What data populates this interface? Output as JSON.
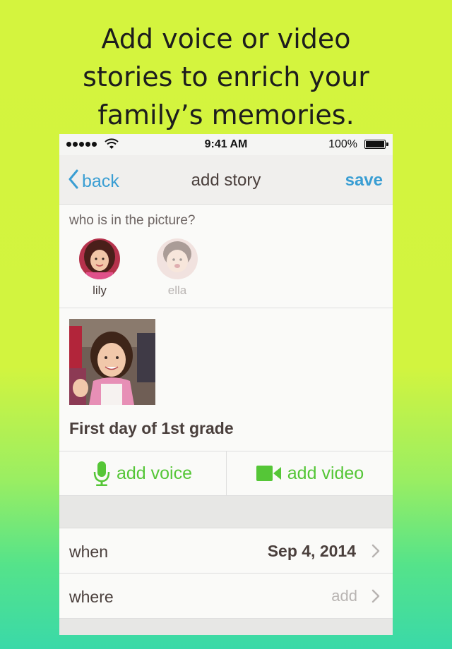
{
  "headline": {
    "line1": "Add voice or video",
    "line2": "stories to enrich your",
    "line3": "family’s memories."
  },
  "status_bar": {
    "time": "9:41 AM",
    "battery": "100%"
  },
  "nav": {
    "back_label": "back",
    "title": "add story",
    "save_label": "save"
  },
  "people": {
    "prompt": "who is in the picture?",
    "items": [
      {
        "name": "lily",
        "selected": true
      },
      {
        "name": "ella",
        "selected": false
      }
    ]
  },
  "story": {
    "caption": "First day of 1st grade"
  },
  "actions": {
    "voice_label": "add voice",
    "video_label": "add video"
  },
  "details": {
    "when_label": "when",
    "when_value": "Sep 4, 2014",
    "where_label": "where",
    "where_value": "add"
  },
  "colors": {
    "accent_blue": "#3a9ed3",
    "accent_green": "#55c637",
    "text_dark": "#4a3f3c"
  }
}
